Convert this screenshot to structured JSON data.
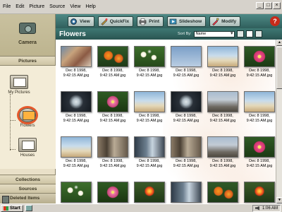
{
  "menu": [
    "File",
    "Edit",
    "Picture",
    "Source",
    "View",
    "Help"
  ],
  "window_buttons": [
    "_",
    "□",
    "×"
  ],
  "toolbar": {
    "buttons": [
      {
        "label": "View",
        "icon": "view-icon"
      },
      {
        "label": "QuickFix",
        "icon": "quickfix-icon"
      },
      {
        "label": "Print",
        "icon": "printer-icon"
      },
      {
        "label": "Slideshow",
        "icon": "slideshow-icon"
      },
      {
        "label": "Modify",
        "icon": "modify-icon"
      }
    ],
    "help_label": "?"
  },
  "sidebar": {
    "camera_label": "Camera",
    "pictures_label": "Pictures",
    "tree": [
      {
        "label": "My Pictures",
        "selected": false
      },
      {
        "label": "Flowers",
        "selected": true
      },
      {
        "label": "Houses",
        "selected": false
      }
    ],
    "collections_label": "Collections",
    "sources_label": "Sources",
    "deleted_label": "Deleted Items"
  },
  "content": {
    "title": "Flowers",
    "sort_label": "Sort By:",
    "sort_value": "Name"
  },
  "photos": [
    {
      "line1": "Dec 8 1998,",
      "line2": "9:42:15 AM.jpg",
      "style": "t-family"
    },
    {
      "line1": "Dec 8 1998,",
      "line2": "9:42:15 AM.jpg",
      "style": "t-orange"
    },
    {
      "line1": "Dec 8 1998,",
      "line2": "9:42:15 AM.jpg",
      "style": "t-daisy"
    },
    {
      "line1": "Dec 8 1998,",
      "line2": "9:42:15 AM.jpg",
      "style": "t-tall"
    },
    {
      "line1": "Dec 8 1998,",
      "line2": "9:42:15 AM.jpg",
      "style": "t-beach"
    },
    {
      "line1": "Dec 8 1998,",
      "line2": "9:42:15 AM.jpg",
      "style": "t-pink"
    },
    {
      "line1": "Dec 8 1998,",
      "line2": "9:42:15 AM.jpg",
      "style": "t-dark"
    },
    {
      "line1": "Dec 8 1998,",
      "line2": "9:42:15 AM.jpg",
      "style": "t-pink2"
    },
    {
      "line1": "Dec 8 1998,",
      "line2": "9:42:15 AM.jpg",
      "style": "t-beach"
    },
    {
      "line1": "Dec 8 1998,",
      "line2": "9:42:15 AM.jpg",
      "style": "t-dark"
    },
    {
      "line1": "Dec 8 1998,",
      "line2": "9:42:15 AM.jpg",
      "style": "t-street"
    },
    {
      "line1": "Dec 8 1998,",
      "line2": "9:42:15 AM.jpg",
      "style": "t-beach"
    },
    {
      "line1": "Dec 8 1998,",
      "line2": "9:42:15 AM.jpg",
      "style": "t-beach"
    },
    {
      "line1": "Dec 8 1998,",
      "line2": "9:42:15 AM.jpg",
      "style": "t-arch"
    },
    {
      "line1": "Dec 8 1998,",
      "line2": "9:42:15 AM.jpg",
      "style": "t-window"
    },
    {
      "line1": "Dec 8 1998,",
      "line2": "9:42:15 AM.jpg",
      "style": "t-arch"
    },
    {
      "line1": "Dec 8 1998,",
      "line2": "9:42:15 AM.jpg",
      "style": "t-street"
    },
    {
      "line1": "Dec 8 1998,",
      "line2": "9:42:15 AM.jpg",
      "style": "t-pink"
    },
    {
      "line1": "",
      "line2": "",
      "style": "t-daisy"
    },
    {
      "line1": "",
      "line2": "",
      "style": "t-pink2"
    },
    {
      "line1": "",
      "line2": "",
      "style": "t-red"
    },
    {
      "line1": "",
      "line2": "",
      "style": "t-window"
    },
    {
      "line1": "",
      "line2": "",
      "style": "t-orange"
    },
    {
      "line1": "",
      "line2": "",
      "style": "t-red"
    }
  ],
  "taskbar": {
    "start_label": "Start",
    "clock": "1:06 AM"
  },
  "colors": {
    "toolbar": "#2f5f5c",
    "sidebar": "#e9e0c8",
    "selection_ring": "#e6592b",
    "help": "#c62a1a"
  }
}
